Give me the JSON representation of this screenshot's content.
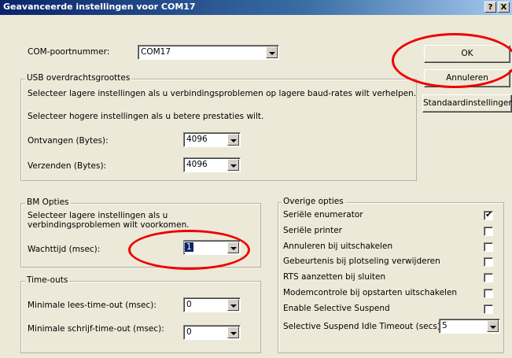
{
  "window": {
    "title": "Geavanceerde instellingen voor COM17",
    "help_btn": "?",
    "close_btn": "X"
  },
  "com_port": {
    "label": "COM-poortnummer:",
    "value": "COM17"
  },
  "buttons": {
    "ok": "OK",
    "cancel": "Annuleren",
    "defaults": "Standaardinstellingen"
  },
  "usb": {
    "legend": "USB overdrachtsgroottes",
    "desc1": "Selecteer lagere instellingen als u verbindingsproblemen op lagere baud-rates wilt verhelpen.",
    "desc2": "Selecteer hogere instellingen als u betere prestaties wilt.",
    "receive_label": "Ontvangen (Bytes):",
    "receive_value": "4096",
    "send_label": "Verzenden (Bytes):",
    "send_value": "4096"
  },
  "bm": {
    "legend": "BM Opties",
    "desc": "Selecteer lagere instellingen als u verbindingsproblemen wilt voorkomen.",
    "latency_label": "Wachttijd (msec):",
    "latency_value": "1"
  },
  "timeouts": {
    "legend": "Time-outs",
    "read_label": "Minimale lees-time-out (msec):",
    "read_value": "0",
    "write_label": "Minimale schrijf-time-out (msec):",
    "write_value": "0"
  },
  "other": {
    "legend": "Overige opties",
    "items": [
      {
        "label": "Seriële enumerator",
        "checked": true
      },
      {
        "label": "Seriële printer",
        "checked": false
      },
      {
        "label": "Annuleren bij uitschakelen",
        "checked": false
      },
      {
        "label": "Gebeurtenis bij plotseling verwijderen",
        "checked": false
      },
      {
        "label": "RTS aanzetten bij sluiten",
        "checked": false
      },
      {
        "label": "Modemcontrole bij opstarten uitschakelen",
        "checked": false
      },
      {
        "label": "Enable Selective Suspend",
        "checked": false
      }
    ],
    "idle_label": "Selective Suspend Idle Timeout (secs):",
    "idle_value": "5"
  },
  "colors": {
    "annotation": "#e00000",
    "titlebar": "#0a246a",
    "dialog_bg": "#ece9d8"
  }
}
